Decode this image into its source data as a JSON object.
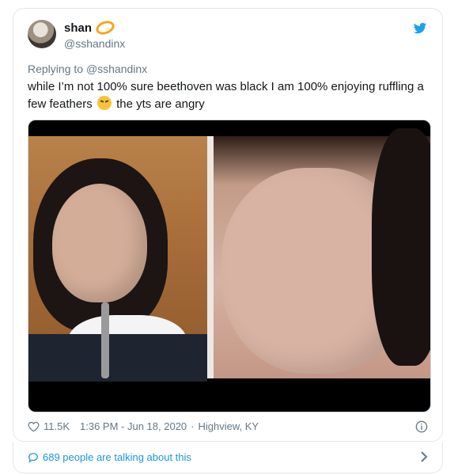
{
  "user": {
    "display_name": "shan",
    "handle": "@sshandinx"
  },
  "tweet": {
    "replying_prefix": "Replying to",
    "replying_handle": "@sshandinx",
    "text_part1": "while I’m not 100% sure beethoven was black I am 100% enjoying ruffling a few feathers",
    "text_part2": "the yts are angry"
  },
  "meta": {
    "likes": "11.5K",
    "timestamp": "1:36 PM - Jun 18, 2020",
    "separator": "·",
    "location": "Highview, KY"
  },
  "footer": {
    "talking_text": "689 people are talking about this"
  },
  "colors": {
    "link_blue": "#1b95e0",
    "twitter_blue": "#1da1f2",
    "secondary_gray": "#657786"
  },
  "icons": [
    "twitter-icon",
    "heart-icon",
    "info-icon",
    "speech-bubble-icon",
    "chevron-right-icon",
    "rolling-laughing-emoji"
  ]
}
